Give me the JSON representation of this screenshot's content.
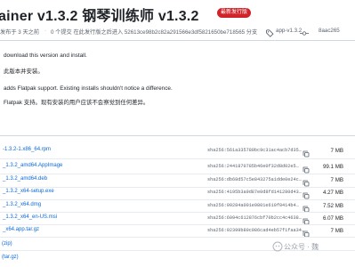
{
  "release": {
    "title": "ainer v1.3.2  钢琴训练师 v1.3.2",
    "badge": "最新发行版"
  },
  "meta": {
    "released": "发布于 3 天之前",
    "commits": "0 个提交 在此发行版之后进入 52613ce98b2c82a291566e3df5821650be718565 分支",
    "tag": "app-v1.3.2",
    "commit_hash": "8aac265"
  },
  "notes": [
    "download this version and install.",
    "此版本并安装。",
    "adds Flatpak support. Existing installs shouldn't notice a difference.",
    "Flatpak 支持。现有安装的用户应该不会察觉到任何差异。"
  ],
  "assets": [
    {
      "name": "-1.3.2-1.x86_64.rpm",
      "sha": "sha256:561a335789bc9c31ac4acb7d35…",
      "size": "7 MB"
    },
    {
      "name": "_1.3.2_amd64.AppImage",
      "sha": "sha256:2441870785b46e0f32d8d02e5…",
      "size": "99.1 MB"
    },
    {
      "name": "_1.3.2_amd64.deb",
      "sha": "sha256:db68d57c5e843275a1dde0e24c…",
      "size": "7 MB"
    },
    {
      "name": "_1.3.2_x64-setup.exe",
      "sha": "sha256:4195b3a9d87e0d8fd141280d43…",
      "size": "4.27 MB"
    },
    {
      "name": "_1.3.2_x64.dmg",
      "sha": "sha256:99284a001e9801e610f0414b4…",
      "size": "7.52 MB"
    },
    {
      "name": "_1.3.2_x64_en-US.msi",
      "sha": "sha256:6094c612876cbf70b2cc4c4638…",
      "size": "6.07 MB"
    },
    {
      "name": "_x64.app.tar.gz",
      "sha": "sha256:92399b80c986cad4eb57f1faa34…",
      "size": "7 MB"
    }
  ],
  "source": [
    "(zip)",
    "(tar.gz)"
  ],
  "watermark": "公众号 · 魏"
}
